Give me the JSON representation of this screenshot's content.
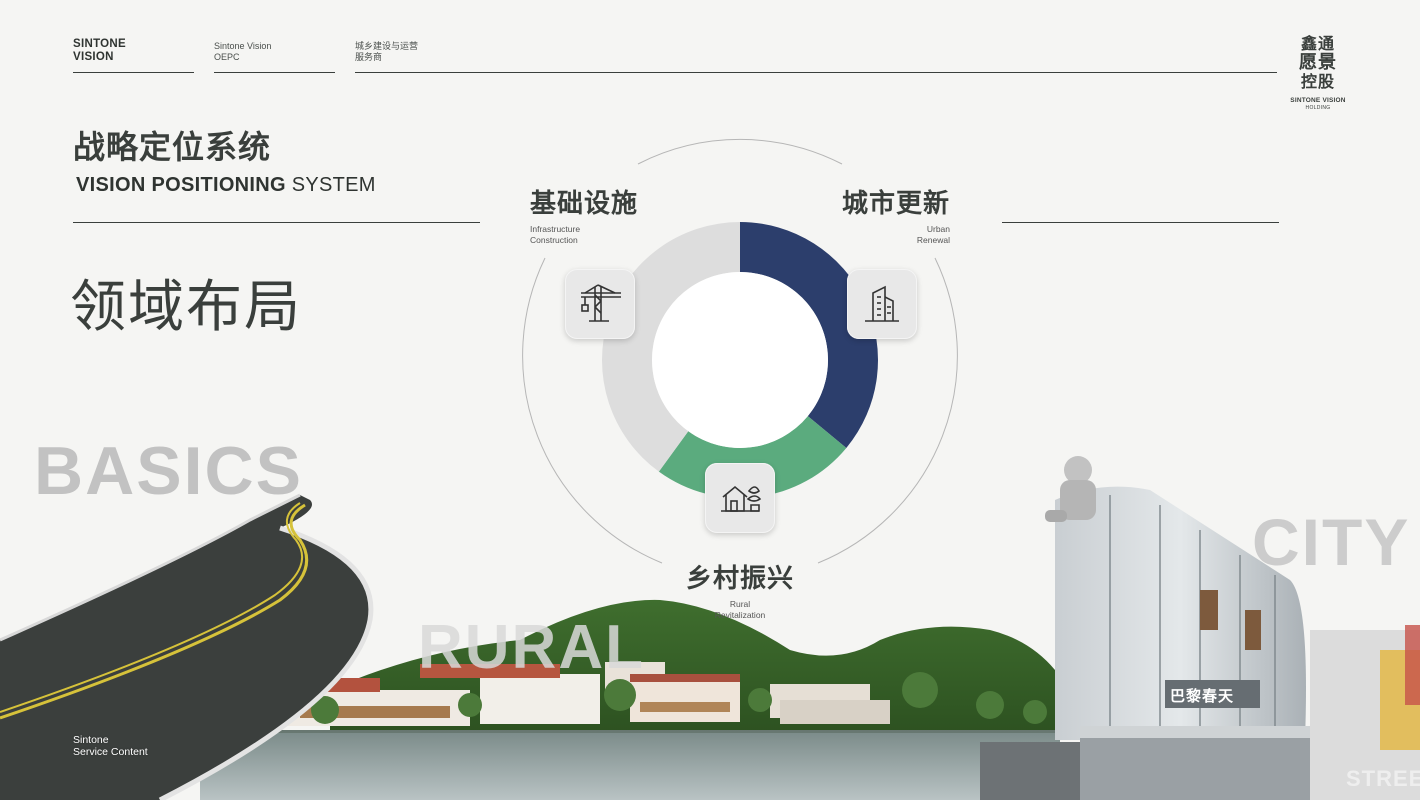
{
  "header": {
    "brand": [
      "SINTONE",
      "VISION"
    ],
    "col2": [
      "Sintone Vision",
      "OEPC"
    ],
    "col3": [
      "城乡建设与运营",
      "服务商"
    ]
  },
  "logo": {
    "cn": [
      "鑫通",
      "愿景",
      "控股"
    ],
    "en": "SINTONE VISION",
    "sub": "HOLDING"
  },
  "title": {
    "cn": "战略定位系统",
    "en_bold": "VISION POSITIONING",
    "en_light": " SYSTEM"
  },
  "domain_heading": "领域布局",
  "service": [
    "Sintone",
    "Service Content"
  ],
  "sections": {
    "infrastructure": {
      "cn": "基础设施",
      "en": [
        "Infrastructure",
        "Construction"
      ],
      "icon": "crane-icon"
    },
    "urban": {
      "cn": "城市更新",
      "en": [
        "Urban",
        "Renewal"
      ],
      "icon": "building-icon"
    },
    "rural": {
      "cn": "乡村振兴",
      "en": [
        "Rural",
        "Revitalization"
      ],
      "icon": "house-icon"
    }
  },
  "donut": {
    "segments": [
      {
        "name": "urban",
        "fraction": 0.36,
        "color": "#2c3e6c"
      },
      {
        "name": "rural",
        "fraction": 0.24,
        "color": "#5bab7e"
      },
      {
        "name": "infrastructure",
        "fraction": 0.4,
        "color": "#dddddd"
      }
    ]
  },
  "background_words": {
    "basics": "BASICS",
    "rural": "RURAL",
    "city": "CITY",
    "street": "STREET",
    "sign": "巴黎春天"
  },
  "colors": {
    "navy": "#2c3e6c",
    "green": "#5bab7e",
    "grey": "#dddddd",
    "text": "#3a3f3c"
  }
}
